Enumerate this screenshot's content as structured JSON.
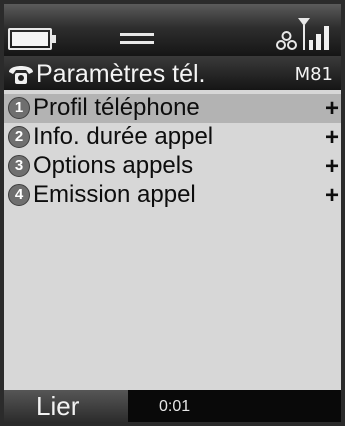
{
  "status": {
    "battery_icon": "battery-full-icon",
    "signal_icon": "signal-strength-icon"
  },
  "title": {
    "icon": "settings-phone-icon",
    "text": "Paramètres tél.",
    "model": "M81"
  },
  "menu": {
    "items": [
      {
        "number": "1",
        "label": "Profil téléphone",
        "more": "+",
        "selected": true
      },
      {
        "number": "2",
        "label": "Info. durée appel",
        "more": "+"
      },
      {
        "number": "3",
        "label": "Options appels",
        "more": "+"
      },
      {
        "number": "4",
        "label": "Emission appel",
        "more": "+"
      }
    ]
  },
  "softkeys": {
    "left": "Lier",
    "time": "0:01"
  },
  "colors": {
    "list_background": "#d7d7d7",
    "selection": "#b3b3b3"
  }
}
